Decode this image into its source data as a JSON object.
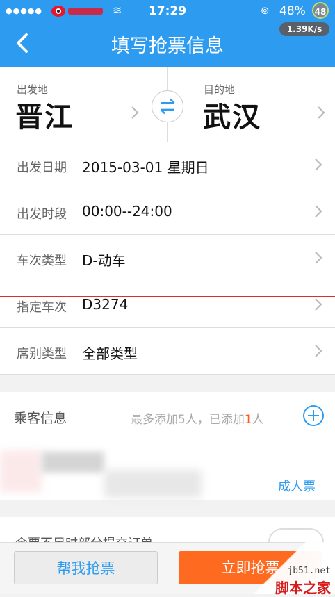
{
  "status_bar": {
    "signal": "●●●●●",
    "time": "17:29",
    "battery": "48%",
    "badge": "48",
    "speed": "1.39K/s"
  },
  "nav": {
    "title": "填写抢票信息"
  },
  "stations": {
    "from_label": "出发地",
    "from": "晋江",
    "to_label": "目的地",
    "to": "武汉"
  },
  "rows": [
    {
      "label": "出发日期",
      "value": "2015-03-01 星期日"
    },
    {
      "label": "出发时段",
      "value": "00:00--24:00"
    },
    {
      "label": "车次类型",
      "value": "D-动车"
    },
    {
      "label": "指定车次",
      "value": "D3274"
    },
    {
      "label": "席别类型",
      "value": "全部类型"
    }
  ],
  "passenger": {
    "label": "乘客信息",
    "info_prefix": "最多添加5人，已添加",
    "count": "1",
    "info_suffix": "人",
    "ticket_type": "成人票"
  },
  "partial_row": {
    "label": "余票不足时部分提交订单"
  },
  "bottom": {
    "help_label": "帮我抢票",
    "grab_label": "立即抢票"
  },
  "watermark": {
    "url": "jb51.net",
    "name": "脚本之家"
  },
  "colors": {
    "accent": "#2d9cf0",
    "orange": "#ff6a21"
  }
}
